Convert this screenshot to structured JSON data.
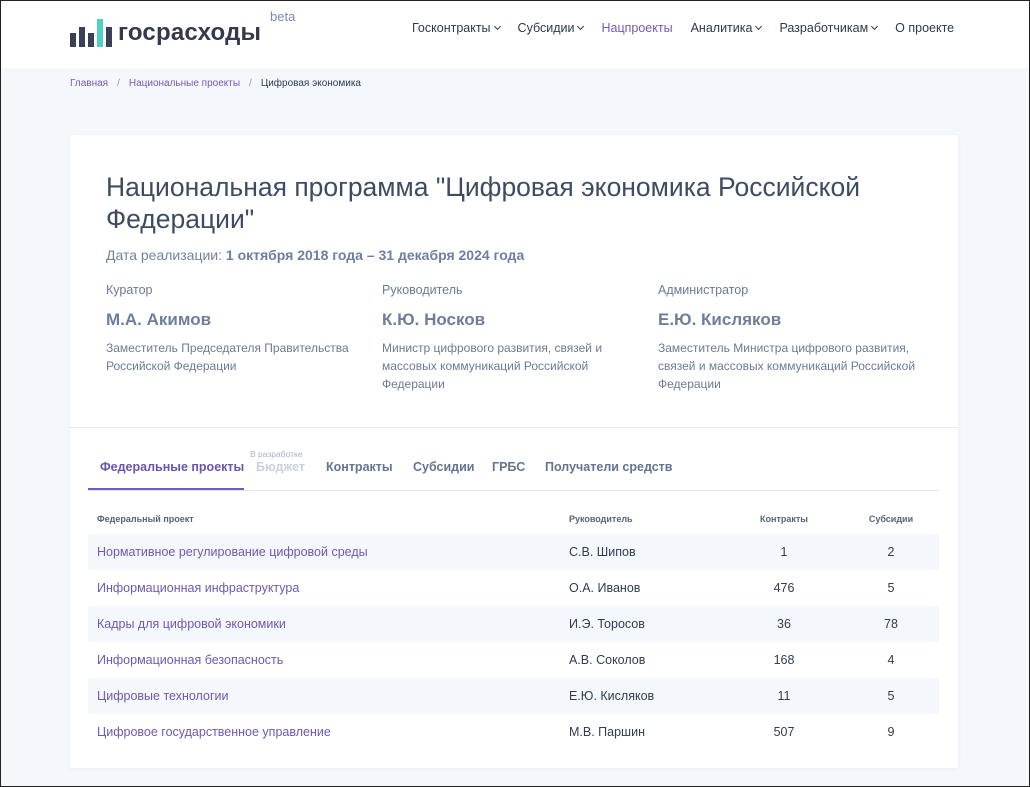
{
  "header": {
    "logo_text": "госрасходы",
    "logo_badge": "beta",
    "nav": [
      {
        "label": "Госконтракты",
        "dropdown": true
      },
      {
        "label": "Субсидии",
        "dropdown": true
      },
      {
        "label": "Нацпроекты",
        "dropdown": false,
        "active": true
      },
      {
        "label": "Аналитика",
        "dropdown": true
      },
      {
        "label": "Разработчикам",
        "dropdown": true
      },
      {
        "label": "О проекте",
        "dropdown": false
      }
    ]
  },
  "breadcrumb": {
    "home": "Главная",
    "section": "Национальные проекты",
    "current": "Цифровая экономика",
    "separator": "/"
  },
  "program": {
    "title": "Национальная программа \"Цифровая экономика Российской Федерации\"",
    "dates_label": "Дата реализации:",
    "dates_value": "1 октября 2018 года – 31 декабря 2024 года",
    "people": [
      {
        "role": "Куратор",
        "name": "М.А. Акимов",
        "position": "Заместитель Председателя Правительства Российской Федерации"
      },
      {
        "role": "Руководитель",
        "name": "К.Ю. Носков",
        "position": "Министр цифрового развития, связей и массовых коммуникаций Российской Федерации"
      },
      {
        "role": "Администратор",
        "name": "Е.Ю. Кисляков",
        "position": "Заместитель Министра цифрового развития, связей и массовых коммуникаций Российской Федерации"
      }
    ]
  },
  "tabs": {
    "federal_projects": "Федеральные проекты",
    "budget": "Бюджет",
    "budget_note": "В разработке",
    "contracts": "Контракты",
    "subsidies": "Субсидии",
    "grbs": "ГРБС",
    "recipients": "Получатели средств"
  },
  "table": {
    "headers": {
      "project": "Федеральный проект",
      "lead": "Руководитель",
      "contracts": "Контракты",
      "subsidies": "Субсидии"
    },
    "rows": [
      {
        "project": "Нормативное регулирование цифровой среды",
        "lead": "С.В. Шипов",
        "contracts": "1",
        "subsidies": "2"
      },
      {
        "project": "Информационная инфраструктура",
        "lead": "О.А. Иванов",
        "contracts": "476",
        "subsidies": "5"
      },
      {
        "project": "Кадры для цифровой экономики",
        "lead": "И.Э. Торосов",
        "contracts": "36",
        "subsidies": "78"
      },
      {
        "project": "Информационная безопасность",
        "lead": "А.В. Соколов",
        "contracts": "168",
        "subsidies": "4"
      },
      {
        "project": "Цифровые технологии",
        "lead": "Е.Ю. Кисляков",
        "contracts": "11",
        "subsidies": "5"
      },
      {
        "project": "Цифровое государственное управление",
        "lead": "М.В. Паршин",
        "contracts": "507",
        "subsidies": "9"
      }
    ]
  },
  "colors": {
    "accent": "#7459b8",
    "logo_teal": "#4fd1c5",
    "logo_dark": "#3b3f58",
    "page_bg": "#f4f8fd"
  }
}
